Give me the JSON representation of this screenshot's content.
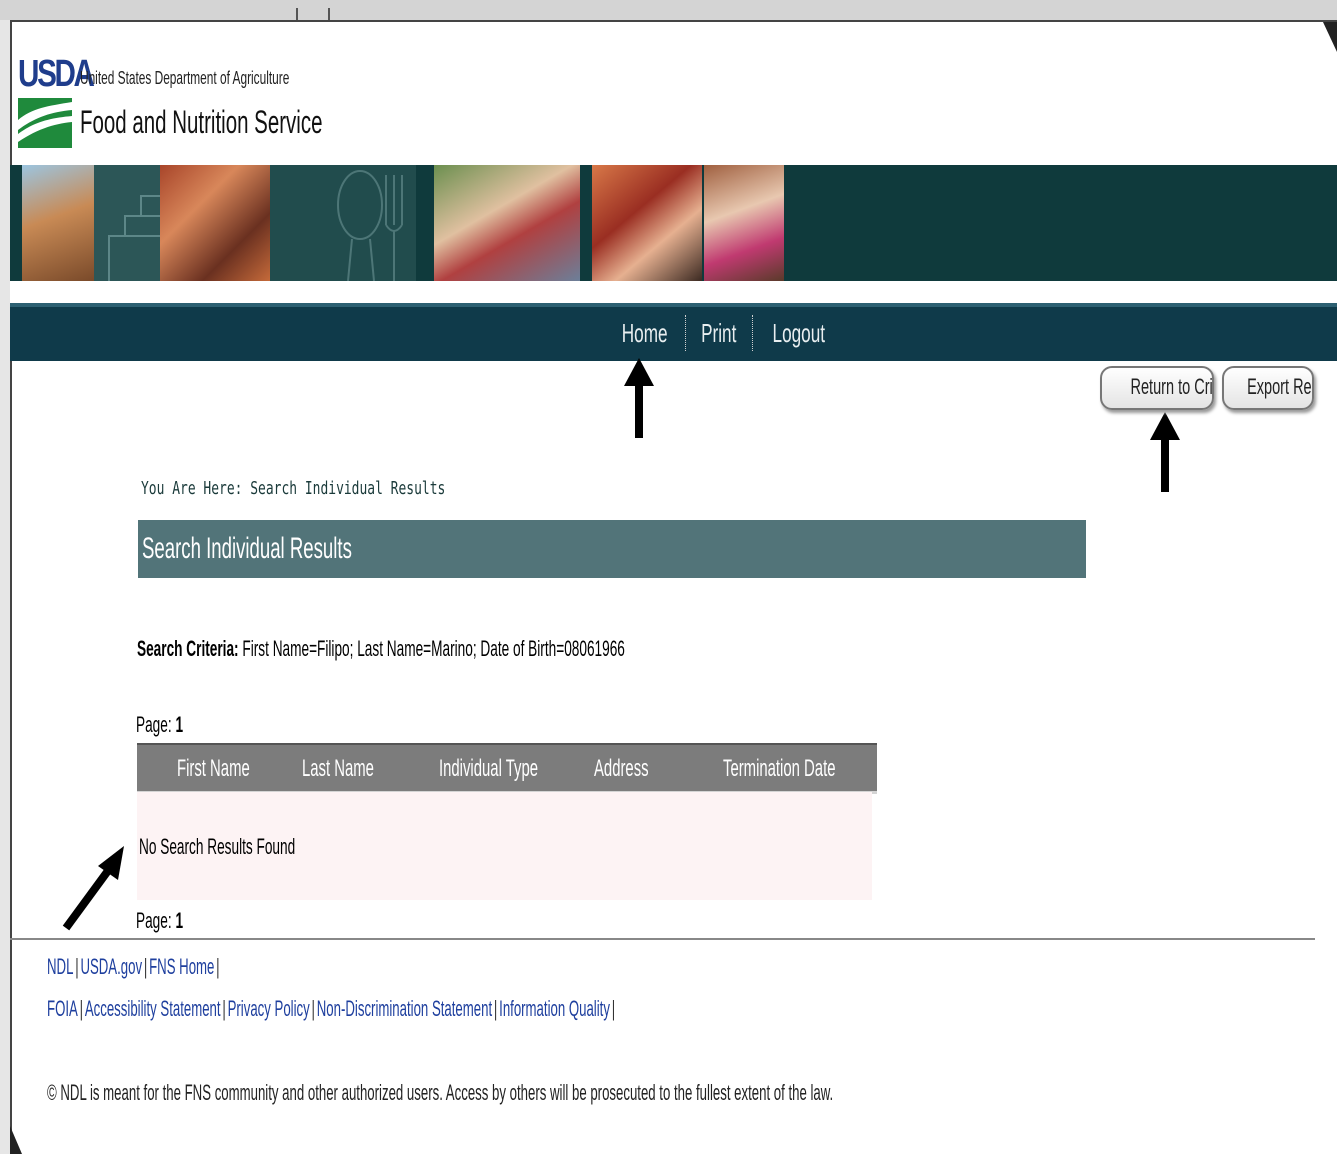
{
  "header": {
    "logo_usda": "USDA",
    "logo_dept": "United States Department of Agriculture",
    "logo_agency": "Food and Nutrition Service"
  },
  "nav": {
    "home": "Home",
    "print": "Print",
    "logout": "Logout"
  },
  "actions": {
    "return_to_criteria": "Return to Criteria",
    "export_report": "Export Report"
  },
  "breadcrumb": "You Are Here: Search Individual Results",
  "page_title": "Search Individual Results",
  "search_criteria": {
    "label": "Search Criteria:",
    "value": "First Name=Filipo; Last Name=Marino; Date of Birth=08061966"
  },
  "pagination": {
    "label": "Page:",
    "current": "1"
  },
  "results_table": {
    "columns": [
      "First Name",
      "Last Name",
      "Individual Type",
      "Address",
      "Termination Date"
    ],
    "empty_message": "No Search Results Found"
  },
  "footer": {
    "links_row1": [
      "NDL",
      "USDA.gov",
      "FNS Home"
    ],
    "links_row2": [
      "FOIA",
      "Accessibility Statement",
      "Privacy Policy",
      "Non-Discrimination Statement",
      "Information Quality"
    ],
    "copyright": "© NDL is meant for the FNS community and other authorized users. Access by others will be prosecuted to the fullest extent of the law."
  },
  "colors": {
    "banner": "#0f3a3c",
    "navbar": "#0f3a4a",
    "title_bar": "#527479",
    "table_header": "#7c7c7c",
    "table_body": "#fdf3f4",
    "link": "#1e3f9e"
  }
}
